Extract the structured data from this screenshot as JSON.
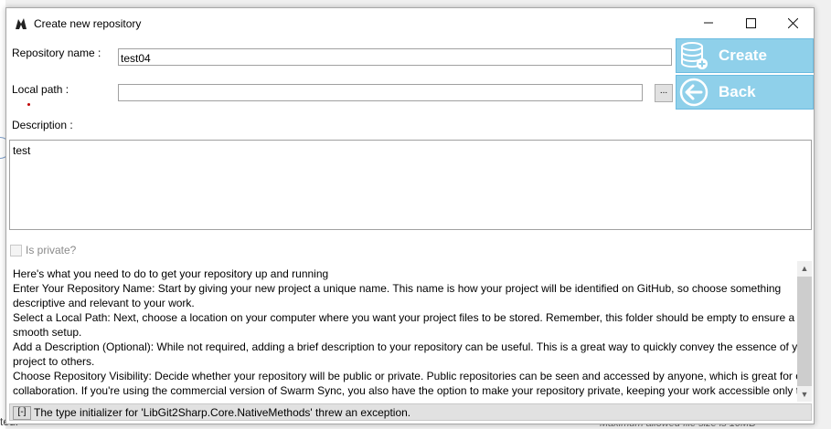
{
  "background": {
    "left_status": "ted.",
    "right_note": "Maximum allowed file size is 10MB"
  },
  "window": {
    "title": "Create new repository",
    "controls": {
      "minimize": "—",
      "maximize": "☐",
      "close": "✕"
    }
  },
  "form": {
    "repo_name_label": "Repository name :",
    "repo_name_value": "test04",
    "local_path_label": "Local path :",
    "local_path_value": "",
    "browse_label": "...",
    "description_label": "Description :",
    "description_value": "test",
    "private_label": "Is private?",
    "private_checked": false
  },
  "buttons": {
    "create_label": "Create",
    "back_label": "Back"
  },
  "info": {
    "lines": [
      "Here's what you need to do to get your repository up and running",
      "Enter Your Repository Name: Start by giving your new project a unique name. This name is how your project will be identified on GitHub, so choose something",
      "descriptive and relevant to your work.",
      "Select a Local Path: Next, choose a location on your computer where you want your project files to be stored. Remember, this folder should be empty to ensure a",
      "smooth setup.",
      "Add a Description (Optional): While not required, adding a brief description to your repository can be useful. This is a great way to quickly convey the essence of your",
      "project to others.",
      "Choose Repository Visibility: Decide whether your repository will be public or private. Public repositories can be seen and accessed by anyone, which is great for open",
      "collaboration. If you're using the commercial version of Swarm Sync, you also have the option to make your repository private, keeping your work accessible only to"
    ]
  },
  "status": {
    "toggle": "[-]",
    "message": "The type initializer for 'LibGit2Sharp.Core.NativeMethods' threw an exception."
  },
  "colors": {
    "button_bg": "#8fd0ea",
    "button_text": "#ffffff",
    "required_marker": "#c00000"
  }
}
